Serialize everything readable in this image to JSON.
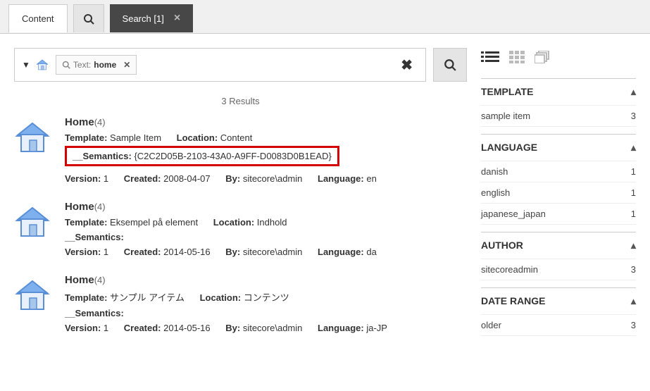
{
  "tabs": {
    "content_label": "Content",
    "search_label": "Search [1]"
  },
  "search": {
    "chip_label": "Text:",
    "chip_value": "home",
    "results_text": "3 Results"
  },
  "results": [
    {
      "title": "Home",
      "count": "(4)",
      "template_label": "Template:",
      "template_val": "Sample Item",
      "location_label": "Location:",
      "location_val": "Content",
      "semantics_label": "__Semantics:",
      "semantics_val": "{C2C2D05B-2103-43A0-A9FF-D0083D0B1EAD}",
      "version_label": "Version:",
      "version_val": "1",
      "created_label": "Created:",
      "created_val": "2008-04-07",
      "by_label": "By:",
      "by_val": "sitecore\\admin",
      "lang_label": "Language:",
      "lang_val": "en",
      "highlight_semantics": true
    },
    {
      "title": "Home",
      "count": "(4)",
      "template_label": "Template:",
      "template_val": "Eksempel på element",
      "location_label": "Location:",
      "location_val": "Indhold",
      "semantics_label": "__Semantics:",
      "semantics_val": "",
      "version_label": "Version:",
      "version_val": "1",
      "created_label": "Created:",
      "created_val": "2014-05-16",
      "by_label": "By:",
      "by_val": "sitecore\\admin",
      "lang_label": "Language:",
      "lang_val": "da",
      "highlight_semantics": false
    },
    {
      "title": "Home",
      "count": "(4)",
      "template_label": "Template:",
      "template_val": "サンプル アイテム",
      "location_label": "Location:",
      "location_val": "コンテンツ",
      "semantics_label": "__Semantics:",
      "semantics_val": "",
      "version_label": "Version:",
      "version_val": "1",
      "created_label": "Created:",
      "created_val": "2014-05-16",
      "by_label": "By:",
      "by_val": "sitecore\\admin",
      "lang_label": "Language:",
      "lang_val": "ja-JP",
      "highlight_semantics": false
    }
  ],
  "facets": {
    "template": {
      "title": "TEMPLATE",
      "items": [
        {
          "name": "sample item",
          "count": "3"
        }
      ]
    },
    "language": {
      "title": "LANGUAGE",
      "items": [
        {
          "name": "danish",
          "count": "1"
        },
        {
          "name": "english",
          "count": "1"
        },
        {
          "name": "japanese_japan",
          "count": "1"
        }
      ]
    },
    "author": {
      "title": "AUTHOR",
      "items": [
        {
          "name": "sitecoreadmin",
          "count": "3"
        }
      ]
    },
    "date_range": {
      "title": "DATE RANGE",
      "items": [
        {
          "name": "older",
          "count": "3"
        }
      ]
    }
  }
}
